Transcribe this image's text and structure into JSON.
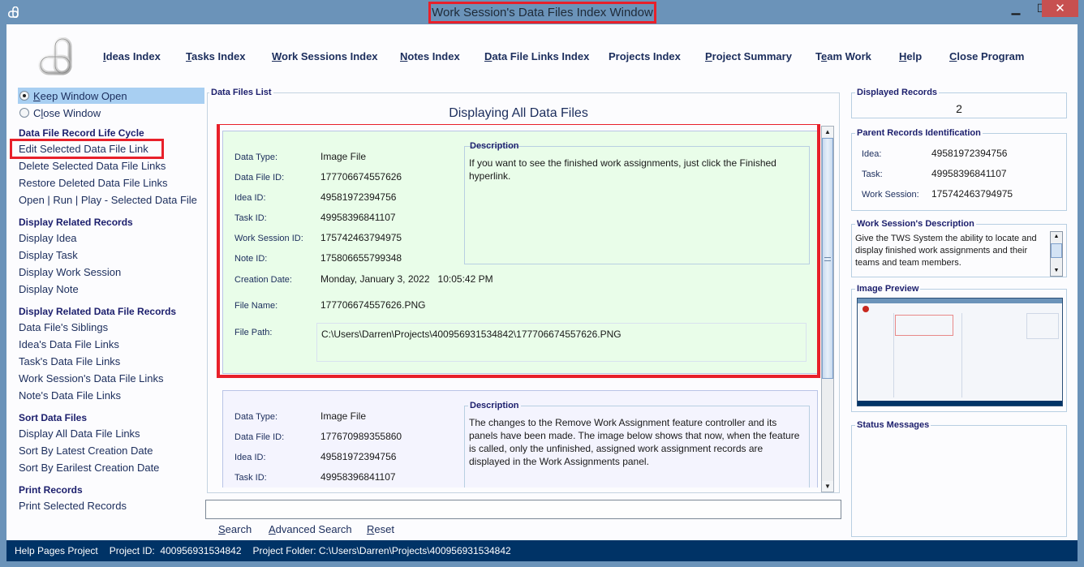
{
  "window": {
    "title": "Work Session's Data Files Index Window",
    "min_glyph": "▁",
    "max_glyph": "☐",
    "close_glyph": "✕"
  },
  "nav": [
    {
      "label": "Ideas Index",
      "mnemonic": "I"
    },
    {
      "label": "Tasks Index",
      "mnemonic": "T"
    },
    {
      "label": "Work Sessions Index",
      "mnemonic": "W"
    },
    {
      "label": "Notes Index",
      "mnemonic": "N"
    },
    {
      "label": "Data File Links Index",
      "mnemonic": "D"
    },
    {
      "label": "Projects Index",
      "mnemonic": ""
    },
    {
      "label": "Project Summary",
      "mnemonic": "P"
    },
    {
      "label": "Team Work",
      "mnemonic": "e"
    },
    {
      "label": "Help",
      "mnemonic": "H"
    },
    {
      "label": "Close Program",
      "mnemonic": "C"
    }
  ],
  "sidebar": {
    "radios": [
      {
        "label": "Keep Window Open",
        "checked": true
      },
      {
        "label": "Close Window",
        "checked": false
      }
    ],
    "sections": [
      {
        "heading": "Data File Record Life Cycle",
        "items": [
          "Edit Selected Data File Link",
          "Delete Selected Data File Links",
          "Restore Deleted Data File Links",
          "Open | Run | Play - Selected Data File"
        ]
      },
      {
        "heading": "Display Related Records",
        "items": [
          "Display Idea",
          "Display Task",
          "Display Work Session",
          "Display Note"
        ]
      },
      {
        "heading": "Display Related Data File Records",
        "items": [
          "Data File's Siblings",
          "Idea's Data File Links",
          "Task's Data File Links",
          "Work Session's Data File Links",
          "Note's Data File Links"
        ]
      },
      {
        "heading": "Sort Data Files",
        "items": [
          "Display All Data File Links",
          "Sort By Latest Creation Date",
          "Sort By Earilest Creation Date"
        ]
      },
      {
        "heading": "Print Records",
        "items": [
          "Print Selected Records"
        ]
      }
    ]
  },
  "list": {
    "legend": "Data Files List",
    "title": "Displaying All Data Files",
    "labels": {
      "data_type": "Data Type:",
      "data_file_id": "Data File ID:",
      "idea_id": "Idea ID:",
      "task_id": "Task ID:",
      "work_session_id": "Work Session ID:",
      "note_id": "Note ID:",
      "creation_date": "Creation Date:",
      "file_name": "File Name:",
      "file_path": "File Path:",
      "description": "Description"
    },
    "records": [
      {
        "data_type": "Image File",
        "data_file_id": "177706674557626",
        "idea_id": "49581972394756",
        "task_id": "49958396841107",
        "work_session_id": "175742463794975",
        "note_id": "175806655799348",
        "creation_date": "Monday, January 3, 2022   10:05:42 PM",
        "file_name": "177706674557626.PNG",
        "file_path": "C:\\Users\\Darren\\Projects\\400956931534842\\177706674557626.PNG",
        "description": "If you want to see the finished work assignments, just click the Finished hyperlink."
      },
      {
        "data_type": "Image File",
        "data_file_id": "177670989355860",
        "idea_id": "49581972394756",
        "task_id": "49958396841107",
        "description": "The changes to the Remove Work Assignment feature controller and its panels have been made. The image below shows that now, when the feature is called, only the unfinished, assigned work assignment records are displayed in the Work Assignments panel."
      }
    ]
  },
  "search": {
    "value": "",
    "search_label": "Search",
    "advanced_label": "Advanced Search",
    "reset_label": "Reset"
  },
  "right": {
    "displayed_legend": "Displayed Records",
    "displayed_count": "2",
    "parent_legend": "Parent Records Identification",
    "parent": [
      {
        "label": "Idea:",
        "value": "49581972394756"
      },
      {
        "label": "Task:",
        "value": "49958396841107"
      },
      {
        "label": "Work Session:",
        "value": "175742463794975"
      }
    ],
    "ws_desc_legend": "Work Session's Description",
    "ws_desc": "Give the TWS System the ability to locate and display finished work assignments and their teams and team members.",
    "preview_legend": "Image Preview",
    "status_legend": "Status Messages"
  },
  "statusbar": {
    "project": "Help Pages Project",
    "project_id": "Project ID:  400956931534842",
    "project_folder": "Project Folder: C:\\Users\\Darren\\Projects\\400956931534842"
  },
  "colors": {
    "titlebar": "#6b93b9",
    "statusbar": "#003366",
    "highlight": "#e8202a",
    "card_selected": "#e9fde9",
    "card": "#f4f4fe"
  }
}
